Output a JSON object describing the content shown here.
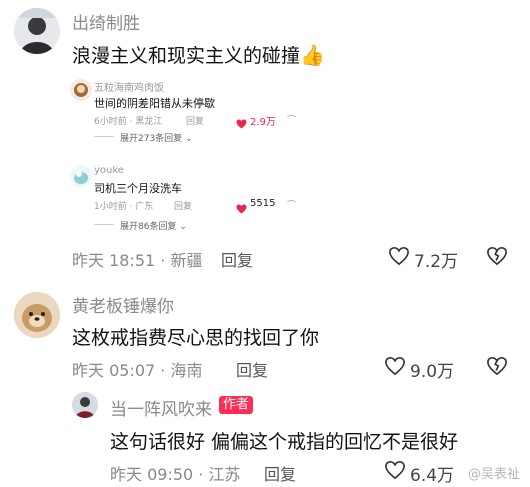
{
  "comments": [
    {
      "username": "出绮制胜",
      "text": "浪漫主义和现实主义的碰撞",
      "emoji": "👍",
      "meta": "昨天 18:51 · 新疆",
      "reply_label": "回复",
      "likes": "7.2万",
      "embedded": {
        "items": [
          {
            "username": "五粒海南鸡肉饭",
            "text": "世间的阴差阳错从未停歇",
            "meta": "6小时前 · 黑龙江",
            "reply_label": "回复",
            "likes": "2.9万",
            "expand": "展开273条回复"
          },
          {
            "username": "youke",
            "text": "司机三个月没洗车",
            "meta": "1小时前 · 广东",
            "reply_label": "回复",
            "likes": "5515",
            "expand": "展开86条回复"
          }
        ]
      }
    },
    {
      "username": "黄老板锤爆你",
      "text": "这枚戒指费尽心思的找回了你",
      "meta": "昨天 05:07 · 海南",
      "reply_label": "回复",
      "likes": "9.0万"
    },
    {
      "username": "当一阵风吹来",
      "author_tag": "作者",
      "text": "这句话很好 偏偏这个戒指的回忆不是很好",
      "meta": "昨天 09:50 · 江苏",
      "reply_label": "回复",
      "likes": "6.4万"
    }
  ],
  "watermark": "@吴表祉",
  "colors": {
    "accent": "#ff2d55",
    "like_red": "#e8294c"
  }
}
